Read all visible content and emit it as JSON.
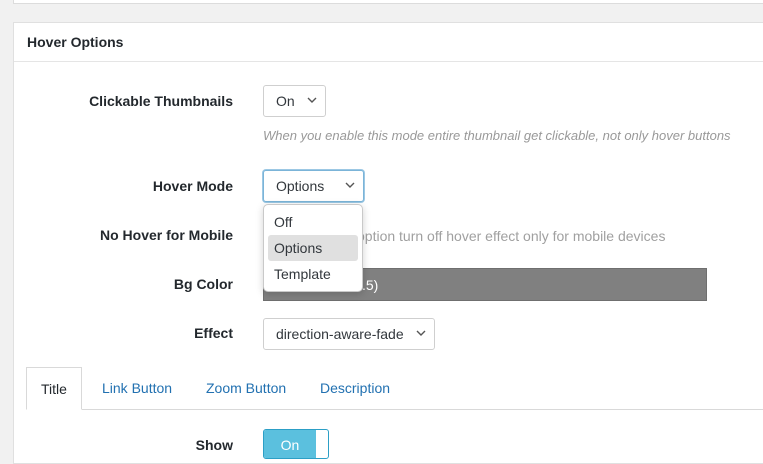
{
  "panel": {
    "title": "Hover Options"
  },
  "fields": {
    "clickable_thumbnails": {
      "label": "Clickable Thumbnails",
      "value": "On",
      "hint": "When you enable this mode entire thumbnail get clickable, not only hover buttons"
    },
    "hover_mode": {
      "label": "Hover Mode",
      "value": "Options",
      "options": [
        "Off",
        "Options",
        "Template"
      ],
      "highlighted": "Options"
    },
    "no_hover_mobile": {
      "label": "No Hover for Mobile",
      "hint_visible": "option turn off hover effect only for mobile devices"
    },
    "bg_color": {
      "label": "Bg Color",
      "value_visible": ".5)",
      "color": "#808080"
    },
    "effect": {
      "label": "Effect",
      "value": "direction-aware-fade"
    },
    "show": {
      "label": "Show",
      "toggle_label": "On"
    }
  },
  "tabs": [
    "Title",
    "Link Button",
    "Zoom Button",
    "Description"
  ],
  "active_tab": "Title",
  "icons": {
    "select_chevron": "chevron-down-icon"
  },
  "colors": {
    "accent": "#2271b1",
    "toggle_on": "#5bc0de"
  }
}
